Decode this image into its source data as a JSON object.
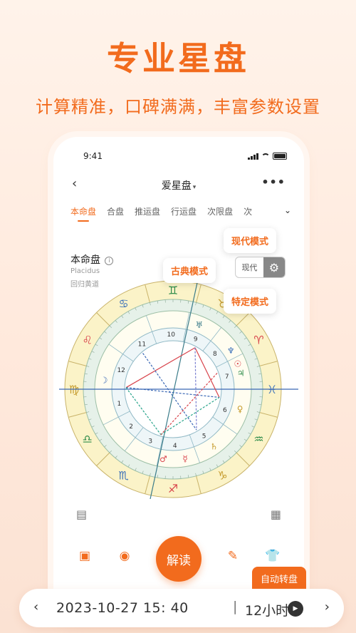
{
  "promo": {
    "headline": "专业星盘",
    "subline": "计算精准，口碑满满，丰富参数设置"
  },
  "status_bar": {
    "time": "9:41"
  },
  "nav": {
    "back_icon": "chevron-left-icon",
    "title": "爱星盘",
    "title_caret": "▾",
    "more": "•••"
  },
  "tabs": [
    {
      "label": "本命盘",
      "active": true
    },
    {
      "label": "合盘"
    },
    {
      "label": "推运盘"
    },
    {
      "label": "行运盘"
    },
    {
      "label": "次限盘"
    },
    {
      "label": "次"
    }
  ],
  "chart_header": {
    "title": "本命盘",
    "info": "i",
    "house_system": "Placidus",
    "zodiac": "回归黄道"
  },
  "mode_selector": {
    "label": "现代",
    "icon": "gear-icon"
  },
  "popovers": {
    "modern": "现代模式",
    "classic": "古典模式",
    "special": "特定模式"
  },
  "toolbar": {
    "save_icon": "save-icon",
    "share_icon": "eye-icon",
    "decode_label": "解读",
    "edit_icon": "pencil-icon",
    "shirt_icon": "shirt-icon"
  },
  "footer": {
    "auto_rotate_label": "自动转盘",
    "datetime": "2023-10-27 15: 40",
    "separator": "|",
    "step": "12小时",
    "prev_icon": "chevron-left-icon",
    "next_icon": "chevron-right-icon",
    "play_icon": "play-icon"
  },
  "wheel": {
    "signs": [
      "♈",
      "♉",
      "♊",
      "♋",
      "♌",
      "♍",
      "♎",
      "♏",
      "♐",
      "♑",
      "♒",
      "♓"
    ],
    "sign_colors": [
      "#d8434b",
      "#c59a2a",
      "#2e8c4a",
      "#3b70b9",
      "#d8434b",
      "#c59a2a",
      "#2e8c4a",
      "#3b70b9",
      "#d8434b",
      "#c59a2a",
      "#2e8c4a",
      "#3b70b9"
    ],
    "houses": [
      "1",
      "2",
      "3",
      "4",
      "5",
      "6",
      "7",
      "8",
      "9",
      "10",
      "11",
      "12"
    ]
  },
  "colors": {
    "accent": "#f26b1d"
  }
}
